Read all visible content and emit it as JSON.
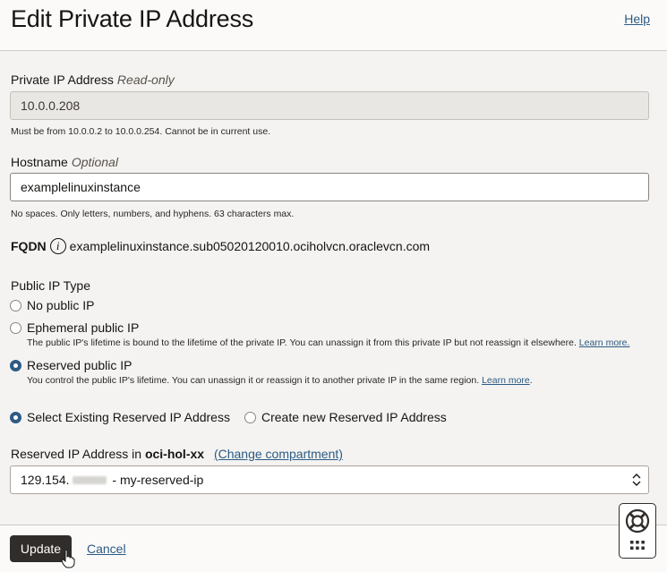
{
  "header": {
    "title": "Edit Private IP Address",
    "help": "Help"
  },
  "private_ip": {
    "label": "Private IP Address",
    "qualifier": "Read-only",
    "value": "10.0.0.208",
    "hint": "Must be from 10.0.0.2 to 10.0.0.254. Cannot be in current use."
  },
  "hostname": {
    "label": "Hostname",
    "qualifier": "Optional",
    "value": "examplelinuxinstance",
    "hint": "No spaces. Only letters, numbers, and hyphens. 63 characters max."
  },
  "fqdn": {
    "label": "FQDN",
    "info_glyph": "i",
    "value": "examplelinuxinstance.sub05020120010.ociholvcn.oraclevcn.com"
  },
  "public_ip_type": {
    "label": "Public IP Type",
    "options": [
      {
        "label": "No public IP",
        "selected": false
      },
      {
        "label": "Ephemeral public IP",
        "selected": false,
        "description": "The public IP's lifetime is bound to the lifetime of the private IP. You can unassign it from this private IP but not reassign it elsewhere.",
        "learn_more": "Learn more."
      },
      {
        "label": "Reserved public IP",
        "selected": true,
        "description": "You control the public IP's lifetime. You can unassign it or reassign it to another private IP in the same region.",
        "learn_more": "Learn more"
      }
    ],
    "trailing_period": "."
  },
  "reserved_mode": {
    "options": [
      {
        "label": "Select Existing Reserved IP Address",
        "selected": true
      },
      {
        "label": "Create new Reserved IP Address",
        "selected": false
      }
    ]
  },
  "reserved_ip": {
    "label_prefix": "Reserved IP Address in",
    "compartment": "oci-hol-xx",
    "change_compartment": "(Change compartment)",
    "value_prefix": "129.154.",
    "value_suffix": " - my-reserved-ip"
  },
  "footer": {
    "update": "Update",
    "cancel": "Cancel"
  },
  "icons": {
    "help_widget": "lifebuoy-icon",
    "apps_widget": "grid-icon",
    "select_arrow": "chevron-up-down-icon"
  }
}
